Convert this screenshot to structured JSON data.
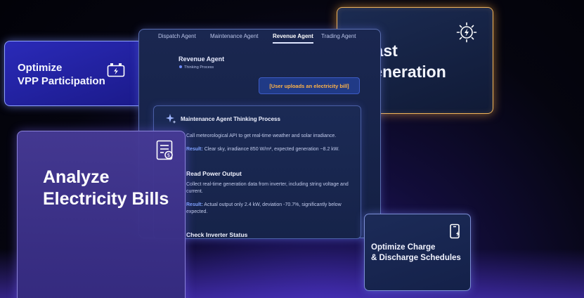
{
  "forecast_card": {
    "title": "recast\nr Generation",
    "icon": "solar-bolt-icon"
  },
  "vpp_card": {
    "title": "Optimize\nVPP Participation",
    "icon": "battery-charging-icon"
  },
  "main_window": {
    "tabs": [
      {
        "label": "Dispatch Agent",
        "active": false
      },
      {
        "label": "Maintenance Agent",
        "active": false
      },
      {
        "label": "Revenue Agent",
        "active": true
      },
      {
        "label": "Trading Agent",
        "active": false
      }
    ],
    "agent_title": "Revenue Agent",
    "agent_status": "Thinking Process",
    "upload_message": "[User uploads an electricity bill]"
  },
  "thinking_panel": {
    "title": "Maintenance Agent Thinking Process",
    "step1_text": "Call meteorological API to get real-time weather and solar irradiance.",
    "step1_result_label": "Result:",
    "step1_result": "Clear sky, irradiance 850 W/m², expected generation ~8.2 kW.",
    "step2_heading": "Read Power Output",
    "step2_text": "Collect real-time generation data from inverter, including string voltage and current.",
    "step2_result_label": "Result:",
    "step2_result": "Actual output only 2.4 kW, deviation -70.7%, significantly below expected.",
    "step3_heading": "Check Inverter Status"
  },
  "bills_card": {
    "title": "Analyze\nElectricity Bills",
    "icon": "bill-document-icon"
  },
  "charge_card": {
    "title": "Optimize Charge\n& Discharge Schedules",
    "icon": "phone-charge-icon"
  }
}
